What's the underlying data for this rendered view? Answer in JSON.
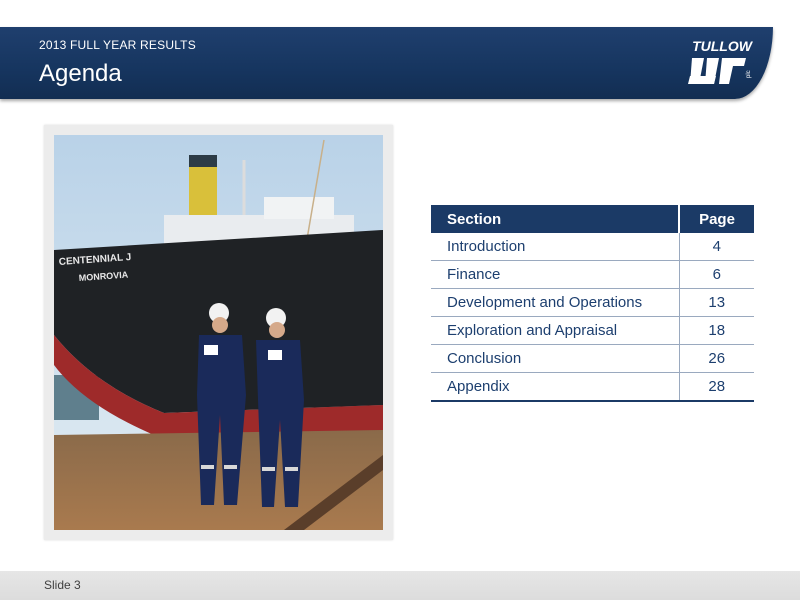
{
  "header": {
    "subtitle": "2013 FULL YEAR RESULTS",
    "title": "Agenda",
    "logo_text": "TULLOW",
    "logo_suffix": "plc"
  },
  "photo": {
    "ship_name": "CENTENNIAL J",
    "ship_port": "MONROVIA"
  },
  "agenda": {
    "headers": {
      "section": "Section",
      "page": "Page"
    },
    "rows": [
      {
        "section": "Introduction",
        "page": "4"
      },
      {
        "section": "Finance",
        "page": "6"
      },
      {
        "section": "Development and Operations",
        "page": "13"
      },
      {
        "section": "Exploration and Appraisal",
        "page": "18"
      },
      {
        "section": "Conclusion",
        "page": "26"
      },
      {
        "section": "Appendix",
        "page": "28"
      }
    ]
  },
  "footer": {
    "slide_label": "Slide 3"
  },
  "colors": {
    "brand_navy": "#1b3a66",
    "text_navy": "#1d3f6f",
    "footer_gray": "#e0e0e0"
  }
}
